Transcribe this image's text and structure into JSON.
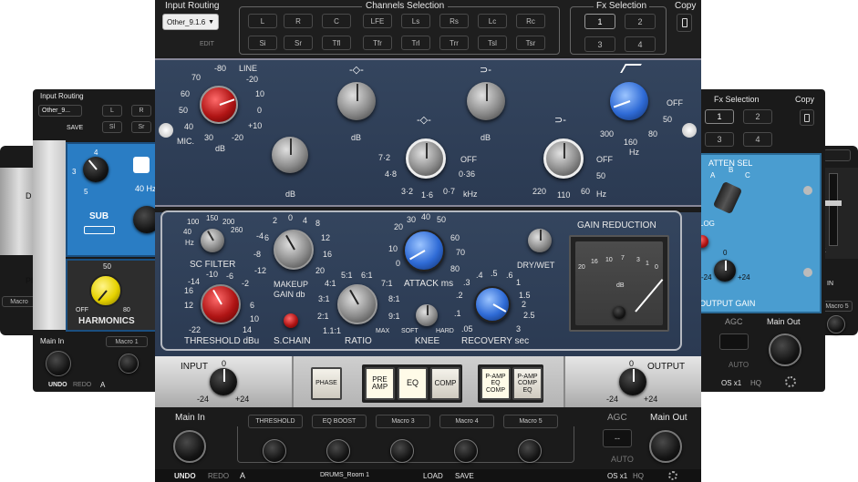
{
  "top": {
    "input_routing": "Input Routing",
    "routing_value": "Other_9.1.6",
    "edit": "EDIT",
    "channels_selection": "Channels Selection",
    "channels_row1": [
      "L",
      "R",
      "C",
      "LFE",
      "Ls",
      "Rs",
      "Lc",
      "Rc"
    ],
    "channels_row2": [
      "Si",
      "Sr",
      "Tfl",
      "Tfr",
      "Trl",
      "Trr",
      "Tsl",
      "Tsr"
    ],
    "fx_selection": "Fx Selection",
    "fx_buttons": [
      "1",
      "2",
      "3",
      "4"
    ],
    "copy": "Copy"
  },
  "eq": {
    "mic_line_knob": {
      "line": "LINE",
      "mic": "MIC.",
      "unit": "dB",
      "scale_left": [
        "-80",
        "70",
        "60",
        "50",
        "40",
        "30"
      ],
      "scale_right": [
        "-20",
        "10",
        "0",
        "+10",
        "-20"
      ]
    },
    "lf_shelf_unit": "dB",
    "hf_shelf_unit": "dB",
    "freq_knob_1": {
      "scale": [
        "7·2",
        "4·8",
        "3·2",
        "1·6",
        "0·7",
        "0·36",
        "OFF"
      ],
      "unit": "kHz"
    },
    "freq_knob_2": {
      "scale": [
        "220",
        "110",
        "60",
        "50",
        "OFF"
      ],
      "unit": "Hz"
    },
    "lowcut_knob": {
      "scale": [
        "OFF",
        "50",
        "80",
        "160",
        "300"
      ],
      "unit": "Hz"
    },
    "lowcut_value_shown": "300",
    "lf_unit": "dB"
  },
  "comp": {
    "gain_reduction": "GAIN REDUCTION",
    "sc_filter": "SC FILTER",
    "sc_scale": [
      "100",
      "150",
      "200",
      "260",
      "40",
      "Hz"
    ],
    "makeup_gain": "MAKEUP",
    "makeup_gain2": "GAIN db",
    "makeup_scale": [
      "0",
      "4",
      "2",
      "6",
      "8",
      "-4",
      "-8",
      "-12",
      "12",
      "16",
      "20"
    ],
    "attack": "ATTACK ms",
    "attack_scale": [
      "30",
      "40",
      "50",
      "20",
      "60",
      "10",
      "70",
      "80",
      "0"
    ],
    "dry_wet": "DRY/WET",
    "threshold": "THRESHOLD dBu",
    "threshold_scale": [
      "-10",
      "-6",
      "-2",
      "-14",
      "14",
      "12",
      "16",
      "6",
      "-22",
      "10"
    ],
    "s_chain": "S.CHAIN",
    "ratio": "RATIO",
    "ratio_scale": [
      "5:1",
      "6:1",
      "4:1",
      "7:1",
      "3:1",
      "8:1",
      "2:1",
      "9:1",
      "1.1:1",
      "MAX"
    ],
    "knee": "KNEE",
    "knee_scale": [
      "SOFT",
      "HARD"
    ],
    "recovery": "RECOVERY sec",
    "recovery_scale": [
      ".4",
      ".5",
      ".6",
      ".3",
      "1",
      ".2",
      "1.5",
      ".1",
      "2.5",
      "2",
      ".05",
      "3"
    ],
    "meter_scale": [
      "20",
      "10",
      "7",
      "3",
      "1",
      "0",
      "16"
    ],
    "meter_unit": "dB"
  },
  "io": {
    "input": "INPUT",
    "output": "OUTPUT",
    "in_scale": [
      "0",
      "-24",
      "+24"
    ],
    "out_scale": [
      "0",
      "-24",
      "+24"
    ],
    "phase": "PHASE",
    "pre_amp": "PRE AMP",
    "eq": "EQ",
    "comp": "COMP",
    "p_amp_eq_comp": "P-AMP EQ COMP",
    "p_amp_comp_eq": "P-AMP COMP EQ"
  },
  "bottom": {
    "main_in": "Main In",
    "macros": [
      "THRESHOLD",
      "EQ BOOST",
      "Macro 3",
      "Macro 4",
      "Macro 5"
    ],
    "agc": "AGC",
    "main_out": "Main Out",
    "agc_value": "--",
    "auto": "AUTO",
    "undo": "UNDO",
    "redo": "REDO",
    "a_label": "A",
    "preset": "DRUMS_Room 1",
    "load": "LOAD",
    "save": "SAVE",
    "os": "OS x1",
    "hq": "HQ"
  },
  "left_plugin": {
    "input_routing": "Input Routing",
    "routing_value": "Other_9...",
    "save": "SAVE",
    "buttons": [
      "L",
      "R",
      "Sl",
      "Sr"
    ],
    "sub": "SUB",
    "sub_hz": "40 Hz",
    "harmonics": "HARMONICS",
    "harm_scale": [
      "50",
      "OFF",
      "80"
    ],
    "blue_scale": [
      "3",
      "4",
      "5"
    ],
    "main_in": "Main In",
    "macro": "Macro 1",
    "undo": "UNDO",
    "redo": "REDO",
    "a": "A"
  },
  "right_plugin": {
    "fx_selection": "Fx Selection",
    "copy": "Copy",
    "fx_buttons": [
      "1",
      "2",
      "3",
      "4"
    ],
    "atten_sel": "ATTEN SEL",
    "atten_scale": [
      "A",
      "B",
      "C"
    ],
    "log": "LOG",
    "output_gain": "OUTPUT GAIN",
    "og_scale": [
      "0",
      "-24",
      "+24"
    ],
    "agc": "AGC",
    "main_out": "Main Out",
    "auto": "AUTO",
    "os": "OS x1",
    "hq": "HQ"
  },
  "far_left": {
    "label_d": "D",
    "label_pl": "Pl",
    "macro": "Macro"
  },
  "far_right": {
    "label_k": "K",
    "label_in": "IN",
    "macro": "Macro 5"
  }
}
